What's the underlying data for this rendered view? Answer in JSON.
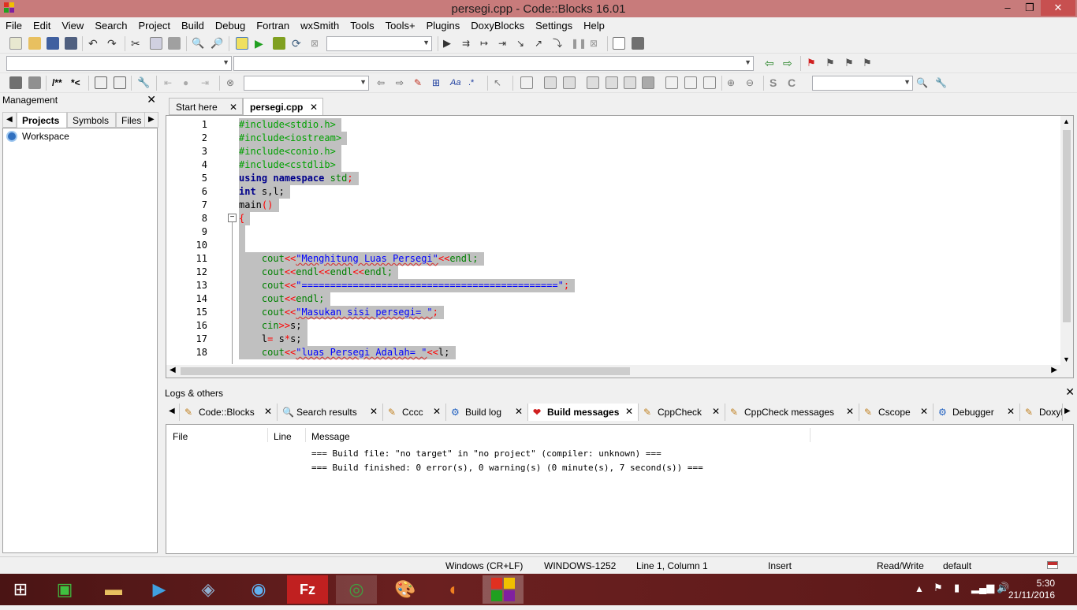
{
  "window": {
    "title": "persegi.cpp - Code::Blocks 16.01",
    "min": "–",
    "max": "❐",
    "close": "✕"
  },
  "menu": [
    "File",
    "Edit",
    "View",
    "Search",
    "Project",
    "Build",
    "Debug",
    "Fortran",
    "wxSmith",
    "Tools",
    "Tools+",
    "Plugins",
    "DoxyBlocks",
    "Settings",
    "Help"
  ],
  "toolbar": {
    "comment_label": "/**",
    "uncomment_label": "*<",
    "regex_label": ".*"
  },
  "management": {
    "title": "Management",
    "close": "✕",
    "tabs": [
      "Projects",
      "Symbols",
      "Files"
    ],
    "tree": {
      "workspace": "Workspace"
    }
  },
  "editor_tabs": [
    {
      "label": "Start here",
      "close": "✕"
    },
    {
      "label": "persegi.cpp",
      "close": "✕"
    }
  ],
  "code_lines": [
    {
      "n": "1"
    },
    {
      "n": "2"
    },
    {
      "n": "3"
    },
    {
      "n": "4"
    },
    {
      "n": "5"
    },
    {
      "n": "6"
    },
    {
      "n": "7"
    },
    {
      "n": "8"
    },
    {
      "n": "9"
    },
    {
      "n": "10"
    },
    {
      "n": "11"
    },
    {
      "n": "12"
    },
    {
      "n": "13"
    },
    {
      "n": "14"
    },
    {
      "n": "15"
    },
    {
      "n": "16"
    },
    {
      "n": "17"
    },
    {
      "n": "18"
    }
  ],
  "code": {
    "l1": "#include<stdio.h>",
    "l2": "#include<iostream>",
    "l3": "#include<conio.h>",
    "l4": "#include<cstdlib>",
    "l5_kw1": "using",
    "l5_kw2": "namespace",
    "l5_id": "std",
    "l5_end": ";",
    "l6_kw": "int",
    "l6_rest": "s,l;",
    "l7_a": "main",
    "l7_b": "()",
    "l8": "{",
    "l11_a": "cout",
    "l11_b": "<<",
    "l11_c": "\"Menghitung Luas Persegi\"",
    "l11_d": "<<",
    "l11_e": "endl;",
    "l12_a": "cout",
    "l12_b": "<<",
    "l12_c": "endl",
    "l12_d": "<<",
    "l12_e": "endl",
    "l12_f": "<<",
    "l12_g": "endl;",
    "l13_a": "cout",
    "l13_b": "<<",
    "l13_c": "\"=============================================\"",
    "l13_d": ";",
    "l14_a": "cout",
    "l14_b": "<<",
    "l14_c": "endl;",
    "l15_a": "cout",
    "l15_b": "<<",
    "l15_c": "\"Masukan sisi persegi= \"",
    "l15_d": ";",
    "l16_a": "cin",
    "l16_b": ">>",
    "l16_c": "s;",
    "l17_a": "l",
    "l17_b": "=",
    "l17_c": " s",
    "l17_d": "*",
    "l17_e": "s;",
    "l18_a": "cout",
    "l18_b": "<<",
    "l18_c": "\"luas Persegi Adalah= \"",
    "l18_d": "<<",
    "l18_e": "l;"
  },
  "logs": {
    "title": "Logs & others",
    "close": "✕",
    "tabs": [
      {
        "label": "Code::Blocks",
        "close": "✕"
      },
      {
        "label": "Search results",
        "close": "✕"
      },
      {
        "label": "Cccc",
        "close": "✕"
      },
      {
        "label": "Build log",
        "close": "✕"
      },
      {
        "label": "Build messages",
        "close": "✕"
      },
      {
        "label": "CppCheck",
        "close": "✕"
      },
      {
        "label": "CppCheck messages",
        "close": "✕"
      },
      {
        "label": "Cscope",
        "close": "✕"
      },
      {
        "label": "Debugger",
        "close": "✕"
      },
      {
        "label": "DoxyB"
      }
    ],
    "columns": [
      "File",
      "Line",
      "Message"
    ],
    "messages": [
      "=== Build file: \"no target\" in \"no project\" (compiler: unknown) ===",
      "=== Build finished: 0 error(s), 0 warning(s) (0 minute(s), 7 second(s)) ==="
    ]
  },
  "status": {
    "eol": "Windows (CR+LF)",
    "encoding": "WINDOWS-1252",
    "position": "Line 1, Column 1",
    "mode": "Insert",
    "access": "Read/Write",
    "profile": "default"
  },
  "clock": {
    "time": "5:30",
    "date": "21/11/2016"
  }
}
